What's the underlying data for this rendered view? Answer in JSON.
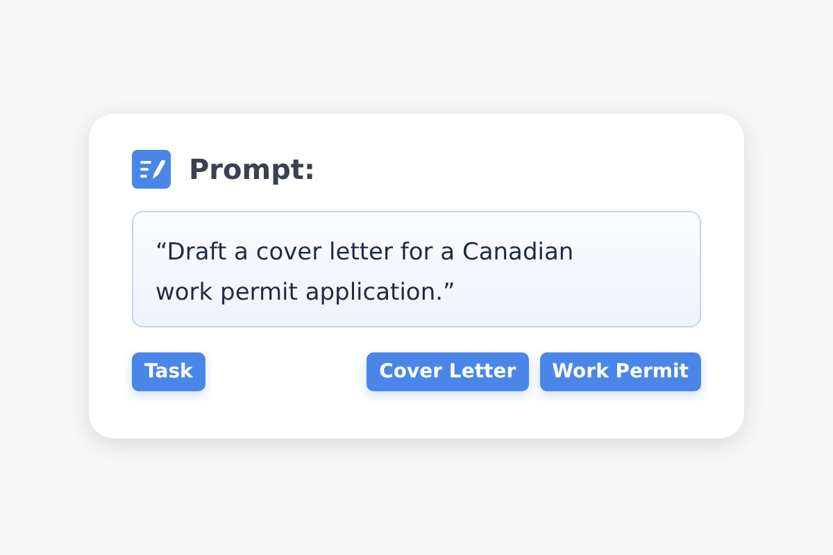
{
  "card": {
    "title": "Prompt:",
    "prompt": "“Draft a cover letter for a Canadian work permit application.”",
    "tags_left": [
      "Task"
    ],
    "tags_right": [
      "Cover Letter",
      "Work Permit"
    ]
  }
}
